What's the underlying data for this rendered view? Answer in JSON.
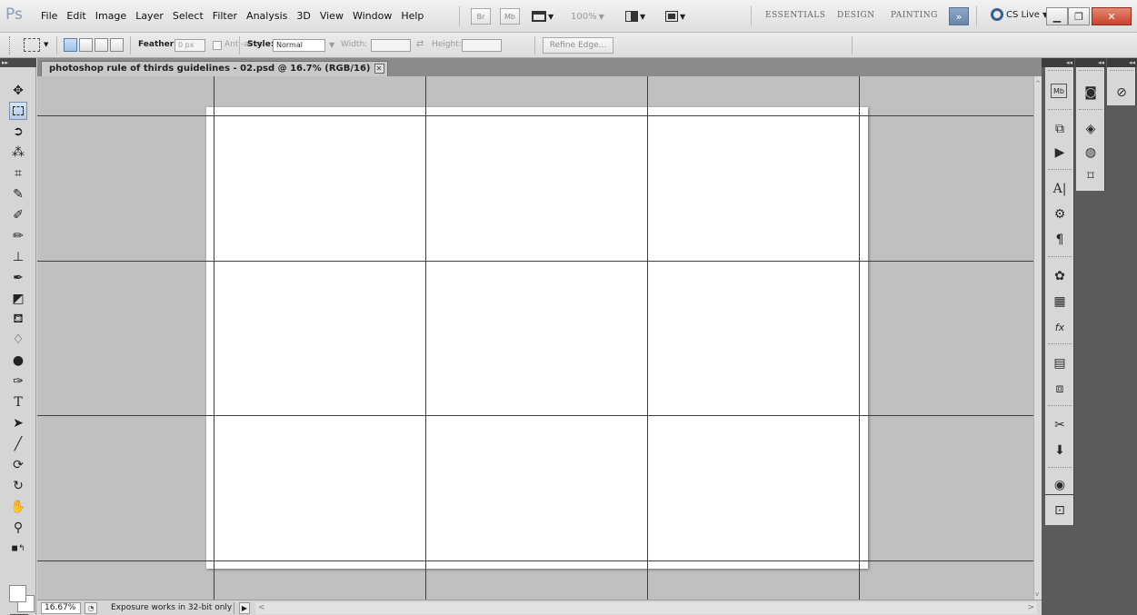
{
  "app": {
    "logo": "Ps",
    "menus": [
      "File",
      "Edit",
      "Image",
      "Layer",
      "Select",
      "Filter",
      "Analysis",
      "3D",
      "View",
      "Window",
      "Help"
    ],
    "zoom_level": "100%",
    "bridge_label": "Br",
    "minibridge_label": "Mb",
    "workspaces": [
      "ESSENTIALS",
      "DESIGN",
      "PAINTING"
    ],
    "more_workspaces": "»",
    "cs_live": "CS Live"
  },
  "options": {
    "feather_label": "Feather:",
    "feather_value": "0 px",
    "antialias_label": "Anti-alias",
    "style_label": "Style:",
    "style_value": "Normal",
    "width_label": "Width:",
    "height_label": "Height:",
    "refine_edge": "Refine Edge..."
  },
  "document": {
    "tab_title": "photoshop rule of thirds guidelines - 02.psd @ 16.7% (RGB/16)",
    "close_glyph": "✕"
  },
  "status": {
    "zoom": "16.67%",
    "info": "Exposure works in 32-bit only"
  },
  "icons": {
    "tools": [
      "move-icon",
      "rect-marquee-icon",
      "lasso-icon",
      "quick-select-icon",
      "crop-icon",
      "eyedropper-icon",
      "spot-heal-icon",
      "brush-icon",
      "clone-stamp-icon",
      "history-brush-icon",
      "eraser-icon",
      "paint-bucket-icon",
      "blur-icon",
      "dodge-icon",
      "pen-icon",
      "type-icon",
      "path-select-icon",
      "line-icon",
      "3d-rotate-icon",
      "3d-orbit-icon",
      "hand-icon",
      "zoom-icon"
    ],
    "panels": [
      "mini-bridge-icon",
      "navigator-icon",
      "history-icon",
      "layers-icon",
      "actions-icon",
      "channels-icon",
      "paths-icon",
      "character-icon",
      "clone-source-icon",
      "paragraph-icon",
      "color-icon",
      "swatches-icon",
      "styles-icon",
      "notes-icon",
      "masks-icon",
      "adjustments-icon",
      "3d-icon",
      "brush-presets-icon",
      "brushes-icon"
    ]
  },
  "colors": {
    "pasteboard": "#c0c0c0",
    "guide": "#3e3e3e",
    "dock": "#5b5b5b"
  }
}
